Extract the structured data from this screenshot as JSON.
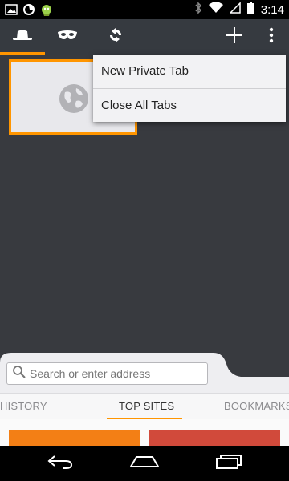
{
  "status_bar": {
    "time": "3:14",
    "icons": [
      "image-icon",
      "firefox-icon",
      "android-icon",
      "bluetooth-icon",
      "wifi-icon",
      "signal-icon",
      "battery-icon"
    ]
  },
  "toolbar": {
    "tabs": [
      "normal-tabs-icon",
      "private-tabs-icon",
      "synced-tabs-icon"
    ],
    "actions": [
      "add-tab-icon",
      "overflow-menu-icon"
    ]
  },
  "menu": {
    "items": [
      {
        "label": "New Private Tab"
      },
      {
        "label": "Close All Tabs"
      }
    ]
  },
  "search": {
    "placeholder": "Search or enter address"
  },
  "panel_tabs": [
    {
      "label": "HISTORY"
    },
    {
      "label": "TOP SITES",
      "active": true
    },
    {
      "label": "BOOKMARKS"
    }
  ],
  "colors": {
    "accent": "#ff9500",
    "background": "#383a3f",
    "tile_orange": "#f37f15",
    "tile_red": "#d14a3b"
  }
}
